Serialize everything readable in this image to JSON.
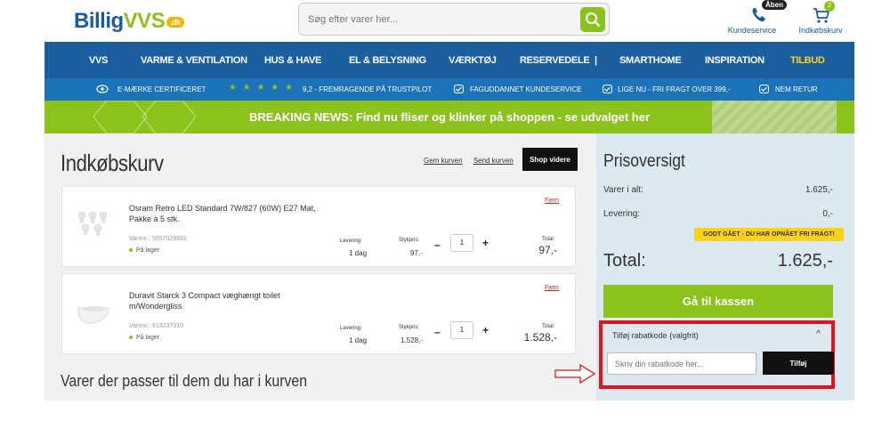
{
  "header": {
    "logo_text": "Billig",
    "logo_accent": "VVS",
    "logo_badge": ".dk",
    "search_placeholder": "Søg efter varer her...",
    "service_badge": "Åben",
    "service_label": "Kundeservice",
    "cart_count": "2",
    "cart_label": "Indkøbskurv"
  },
  "nav": {
    "items": [
      "VVS",
      "VARME & VENTILATION",
      "HUS & HAVE",
      "EL & BELYSNING",
      "VÆRKTØJ",
      "RESERVEDELE",
      "|",
      "SMARTHOME",
      "INSPIRATION",
      "TILBUD"
    ]
  },
  "usp": {
    "items": [
      "E-MÆRKE CERTIFICERET",
      "9,2 - FREMRAGENDE PÅ TRUSTPILOT",
      "FAGUDDANNET KUNDESERVICE",
      "LIGE NU - FRI FRAGT OVER 399,-",
      "NEM RETUR"
    ],
    "stars": "★ ★ ★ ★ ★"
  },
  "news": {
    "text": "BREAKING NEWS: Find nu fliser og klinker på shoppen - se udvalget her"
  },
  "cart": {
    "title": "Indkøbskurv",
    "save_link": "Gem kurven",
    "send_link": "Send kurven",
    "shop_button": "Shop videre",
    "items": [
      {
        "name": "Osram Retro LED Standard 7W/827 (60W) E27 Mat, Pakke à 5 stk.",
        "sku": "Varenr.: 5657029691",
        "stock": "På lager",
        "remove": "Fjern",
        "delivery_label": "Levering:",
        "delivery": "1 dag",
        "unit_label": "Stykpris:",
        "unit_price": "97,-",
        "minus": "–",
        "qty": "1",
        "plus": "+",
        "total_label": "Total:",
        "total": "97,-"
      },
      {
        "name": "Duravit Starck 3 Compact væghængt toilet m/Wondergliss",
        "sku": "Varenr.: 613237010",
        "stock": "På lager",
        "remove": "Fjern",
        "delivery_label": "Levering:",
        "delivery": "1 dag",
        "unit_label": "Stykpris:",
        "unit_price": "1.528,-",
        "minus": "–",
        "qty": "1",
        "plus": "+",
        "total_label": "Total:",
        "total": "1.528,-"
      }
    ],
    "related_title": "Varer der passer til dem du har i kurven"
  },
  "summary": {
    "title": "Prisoversigt",
    "items_label": "Varer i alt:",
    "items_value": "1.625,-",
    "delivery_label": "Levering:",
    "delivery_value": "0,-",
    "free_shipping": "GODT GÅET - DU HAR OPNÅET FRI FRAGT!",
    "total_label": "Total:",
    "total_value": "1.625,-",
    "checkout_button": "Gå til kassen",
    "coupon_title": "Tilføj rabatkode (valgfrit)",
    "coupon_chevron": "^",
    "coupon_placeholder": "Skriv din rabatkode her...",
    "coupon_button": "Tilføj"
  },
  "colors": {
    "brand_blue": "#1c5f9e",
    "brand_green": "#8bc21c",
    "highlight": "#e0141e",
    "sale_yellow": "#ffd21a"
  }
}
